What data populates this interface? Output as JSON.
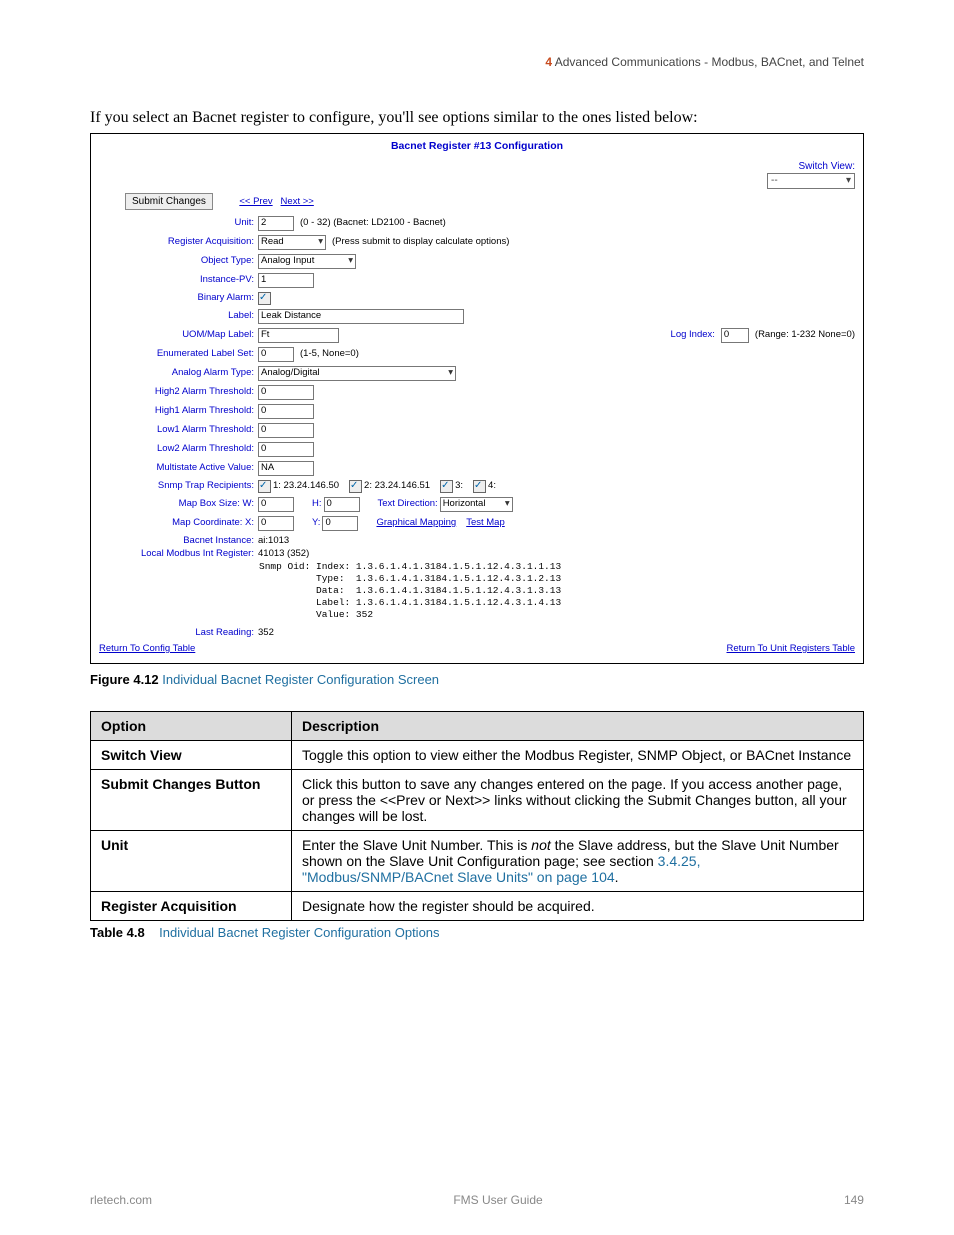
{
  "header": {
    "section_num": "4",
    "section_title": "Advanced Communications - Modbus, BACnet, and Telnet"
  },
  "intro": "If you select an Bacnet register to configure, you'll see options similar to the ones listed below:",
  "shot": {
    "title": "Bacnet Register #13 Configuration",
    "switch_view_label": "Switch View:",
    "switch_view_value": "--",
    "submit_btn": "Submit Changes",
    "prev": "<< Prev",
    "next": "Next >>",
    "rows": {
      "unit": {
        "label": "Unit:",
        "value": "2",
        "hint": "(0 - 32) (Bacnet: LD2100 - Bacnet)"
      },
      "reg_acq": {
        "label": "Register Acquisition:",
        "value": "Read",
        "hint": "(Press submit to display calculate options)"
      },
      "obj_type": {
        "label": "Object Type:",
        "value": "Analog Input"
      },
      "inst_pv": {
        "label": "Instance-PV:",
        "value": "1"
      },
      "bin_alarm": {
        "label": "Binary Alarm:"
      },
      "label": {
        "label": "Label:",
        "value": "Leak Distance"
      },
      "uom": {
        "label": "UOM/Map Label:",
        "value": "Ft",
        "log_label": "Log Index:",
        "log_value": "0",
        "log_hint": "(Range: 1-232 None=0)"
      },
      "enum": {
        "label": "Enumerated Label Set:",
        "value": "0",
        "hint": "(1-5, None=0)"
      },
      "analog_alarm": {
        "label": "Analog Alarm Type:",
        "value": "Analog/Digital"
      },
      "h2": {
        "label": "High2 Alarm Threshold:",
        "value": "0"
      },
      "h1": {
        "label": "High1 Alarm Threshold:",
        "value": "0"
      },
      "l1": {
        "label": "Low1 Alarm Threshold:",
        "value": "0"
      },
      "l2": {
        "label": "Low2 Alarm Threshold:",
        "value": "0"
      },
      "multi": {
        "label": "Multistate Active Value:",
        "value": "NA"
      },
      "snmp_recip": {
        "label": "Snmp Trap Recipients:",
        "r1": "1: 23.24.146.50",
        "r2": "2: 23.24.146.51",
        "r3": "3:",
        "r4": "4:"
      },
      "mapbox": {
        "label": "Map Box Size: W:",
        "w": "0",
        "h_label": "H:",
        "h": "0",
        "td_label": "Text Direction:",
        "td_value": "Horizontal"
      },
      "mapcoord": {
        "label": "Map Coordinate: X:",
        "x": "0",
        "y_label": "Y:",
        "y": "0",
        "gm": "Graphical Mapping",
        "tm": "Test Map"
      },
      "bi": {
        "label": "Bacnet Instance:",
        "value": "ai:1013"
      },
      "lmir": {
        "label": "Local Modbus Int Register:",
        "value": "41013 (352)"
      }
    },
    "snmp_oid": "Snmp Oid: Index: 1.3.6.1.4.1.3184.1.5.1.12.4.3.1.1.13\n          Type:  1.3.6.1.4.1.3184.1.5.1.12.4.3.1.2.13\n          Data:  1.3.6.1.4.1.3184.1.5.1.12.4.3.1.3.13\n          Label: 1.3.6.1.4.1.3184.1.5.1.12.4.3.1.4.13\n          Value: 352",
    "last_reading": {
      "label": "Last Reading:",
      "value": "352"
    },
    "return_config": "Return To Config Table",
    "return_unit": "Return To Unit Registers Table"
  },
  "figure": {
    "num": "Figure 4.12",
    "title": "Individual Bacnet Register Configuration Screen"
  },
  "table": {
    "headers": {
      "option": "Option",
      "desc": "Description"
    },
    "rows": [
      {
        "opt": "Switch View",
        "desc": "Toggle this option to view either the Modbus Register, SNMP Object, or BACnet Instance"
      },
      {
        "opt": "Submit Changes Button",
        "desc": "Click this button to save any changes entered on the page. If you access another page, or press the <<Prev or Next>> links without clicking the Submit Changes button, all your changes will be lost."
      },
      {
        "opt": "Unit",
        "desc_pre": "Enter the Slave Unit Number. This is ",
        "desc_em": "not",
        "desc_mid": " the Slave address, but the Slave Unit Number shown on the Slave Unit Configuration page; see section ",
        "xref1": "3.4.25, \"Modbus/SNMP/BACnet Slave Units\" on page 104",
        "desc_post": "."
      },
      {
        "opt": "Register Acquisition",
        "desc": "Designate how the register should be acquired."
      }
    ]
  },
  "table_caption": {
    "num": "Table 4.8",
    "title": "Individual Bacnet Register Configuration Options"
  },
  "footer": {
    "left": "rletech.com",
    "center": "FMS User Guide",
    "right": "149"
  }
}
